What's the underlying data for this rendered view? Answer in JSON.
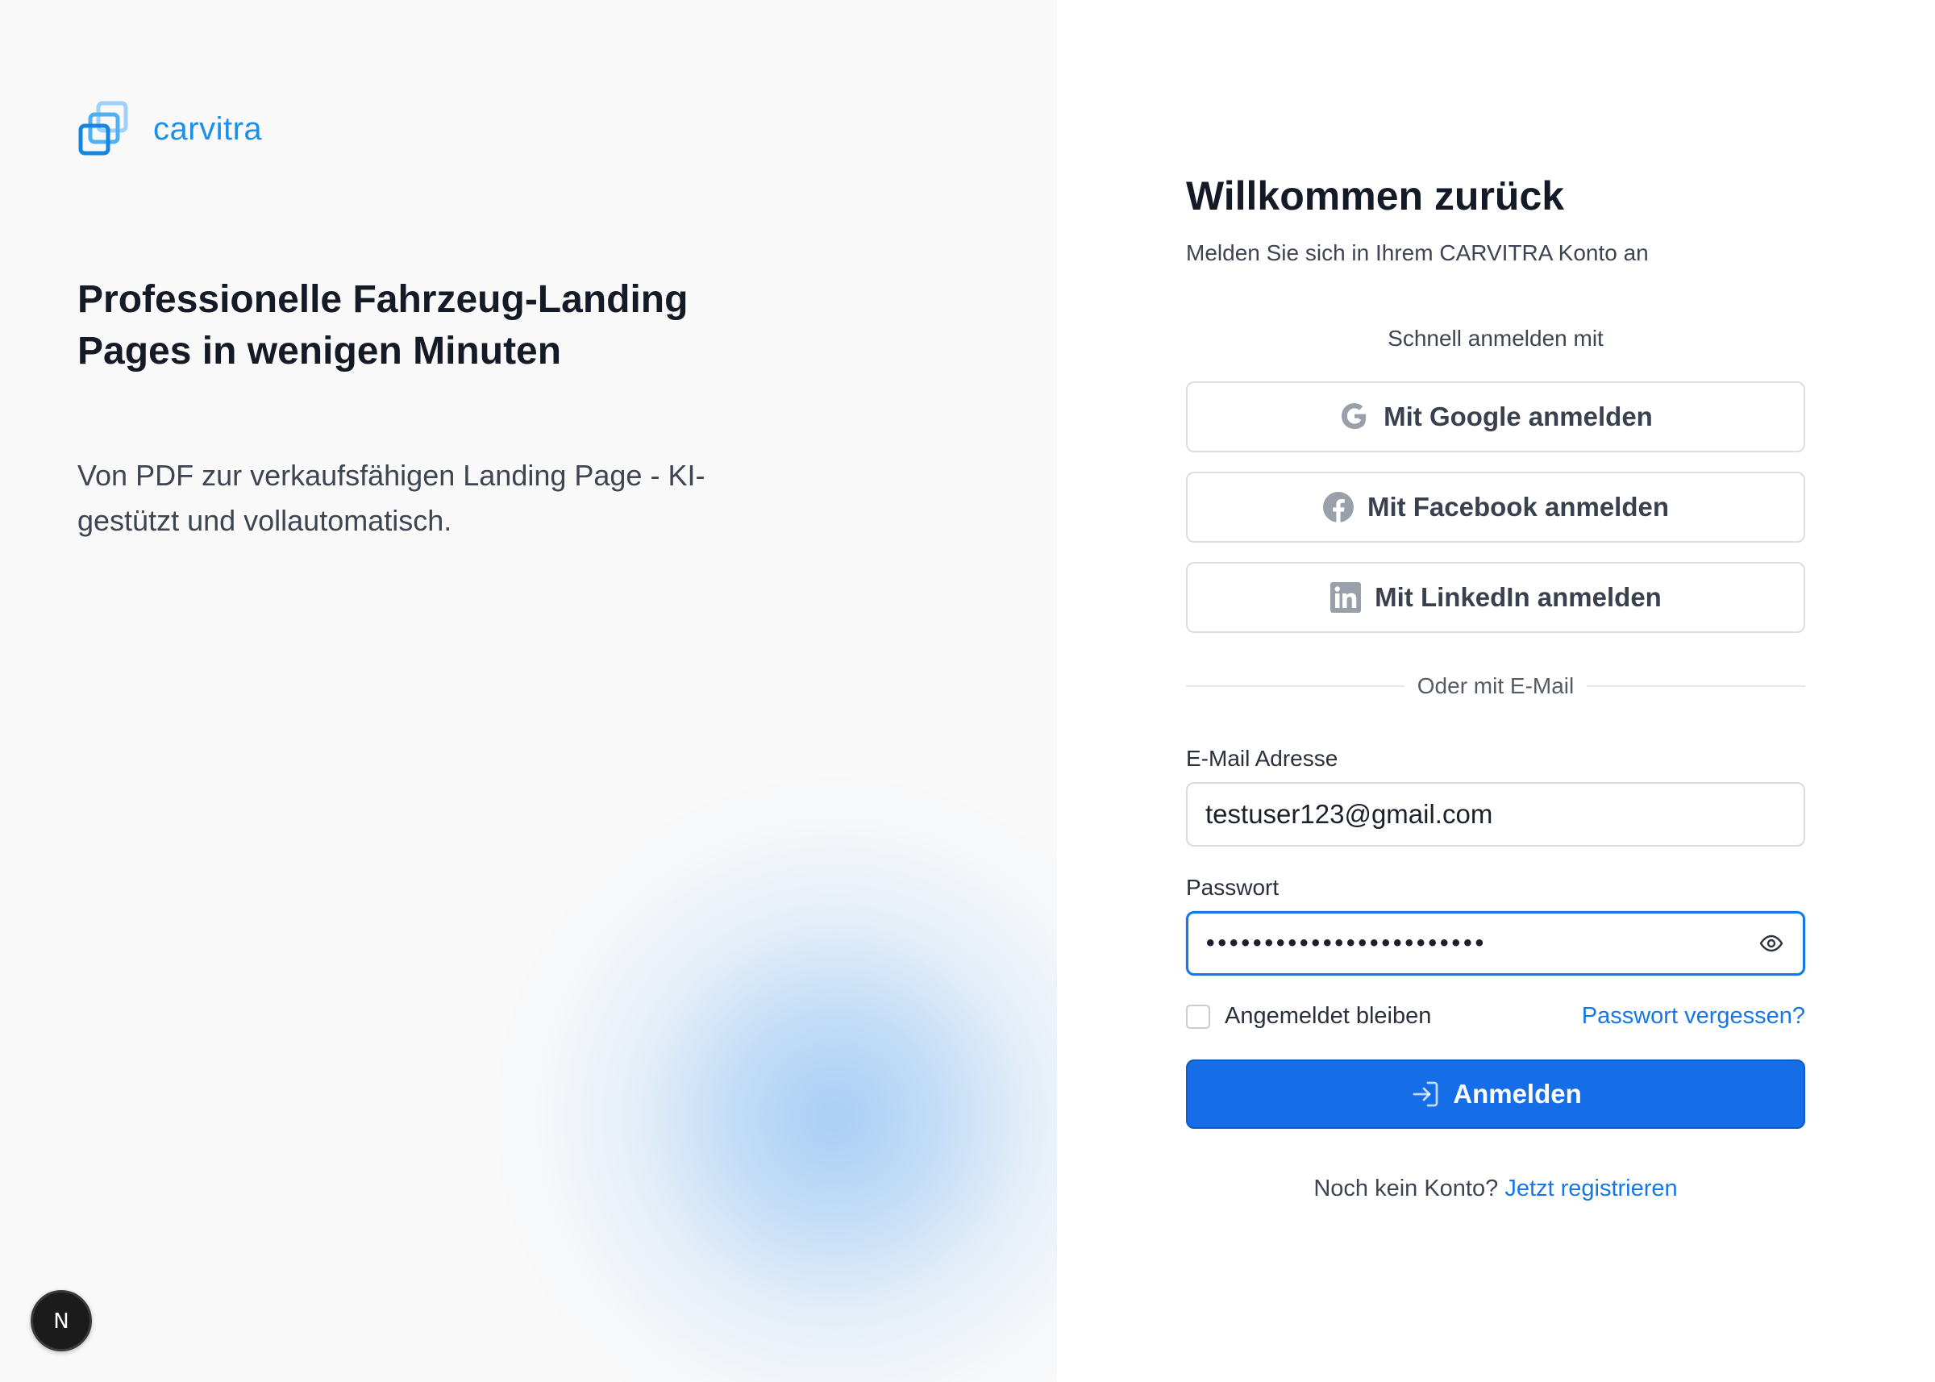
{
  "brand": {
    "name": "carvitra",
    "logo_icon": "layered-squares-icon",
    "accent_color": "#1e8fe6"
  },
  "hero": {
    "title": "Professionelle Fahrzeug-Landing Pages in wenigen Minuten",
    "subtitle": "Von PDF zur verkaufsfähigen Landing Page - KI-gestützt und vollautomatisch."
  },
  "form": {
    "title": "Willkommen zurück",
    "subtitle": "Melden Sie sich in Ihrem CARVITRA Konto an",
    "quick_label": "Schnell anmelden mit",
    "social": {
      "google_label": "Mit Google anmelden",
      "facebook_label": "Mit Facebook anmelden",
      "linkedin_label": "Mit LinkedIn anmelden"
    },
    "divider_text": "Oder mit E-Mail",
    "email": {
      "label": "E-Mail Adresse",
      "value": "testuser123@gmail.com"
    },
    "password": {
      "label": "Passwort",
      "masked_value": "••••••••••••••••••••••••",
      "toggle_icon": "eye-icon"
    },
    "remember_label": "Angemeldet bleiben",
    "forgot_label": "Passwort vergessen?",
    "submit_label": "Anmelden",
    "submit_icon": "sign-in-icon",
    "register_prompt": "Noch kein Konto?",
    "register_link": "Jetzt registrieren",
    "primary_color": "#166de8"
  },
  "dev_badge": {
    "letter": "N"
  }
}
